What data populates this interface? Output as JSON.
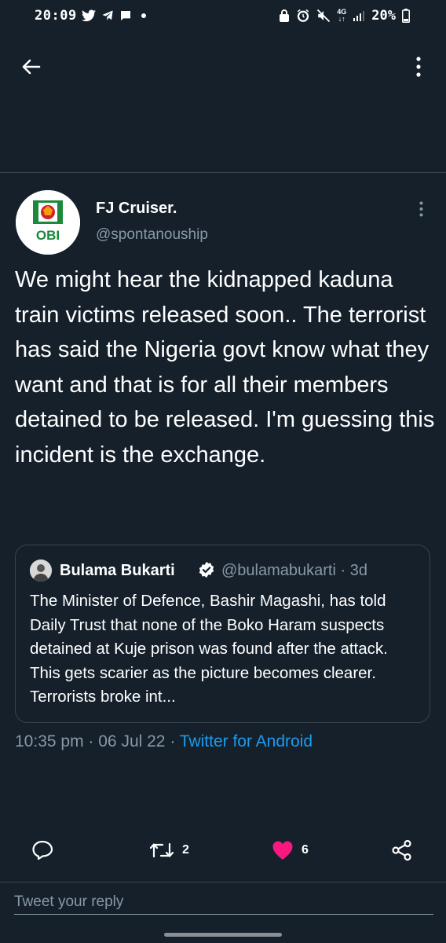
{
  "status_bar": {
    "time": "20:09",
    "network": "4G",
    "battery": "20%",
    "left_icons": [
      "twitter-icon",
      "telegram-icon",
      "chat-bubble-icon",
      "dot-icon"
    ],
    "right_icons": [
      "lock-icon",
      "alarm-icon",
      "mute-icon",
      "network-icon",
      "signal-icon",
      "battery-icon"
    ]
  },
  "header": {
    "back_icon": "back-arrow-icon",
    "more_icon": "more-vertical-icon"
  },
  "tweet": {
    "author_name": "FJ Cruiser.",
    "author_handle": "@spontanouship",
    "avatar_text": "OBI",
    "text": "We might hear the kidnapped kaduna train victims released soon.. The terrorist has said the Nigeria govt know what they want and that is for all their members detained to be released. I'm guessing this incident is the exchange.",
    "time": "10:35 pm",
    "date": "06 Jul 22",
    "source": "Twitter for Android",
    "separator": "·"
  },
  "quoted_tweet": {
    "author_name": "Bulama Bukarti",
    "author_handle": "@bulamabukarti",
    "age": "3d",
    "separator": "·",
    "text": "The Minister of Defence, Bashir Magashi, has told Daily Trust that none of the Boko Haram suspects detained at Kuje prison was found after the attack. This gets scarier as the picture becomes clearer. Terrorists broke int..."
  },
  "actions": {
    "reply_icon": "reply-icon",
    "retweet_count": "2",
    "like_count": "6",
    "share_icon": "share-icon"
  },
  "colors": {
    "background": "#15202b",
    "secondary_text": "#8899a6",
    "link": "#1d9bf0",
    "like": "#f91880",
    "border": "#38444d"
  },
  "reply": {
    "placeholder": "Tweet your reply"
  }
}
